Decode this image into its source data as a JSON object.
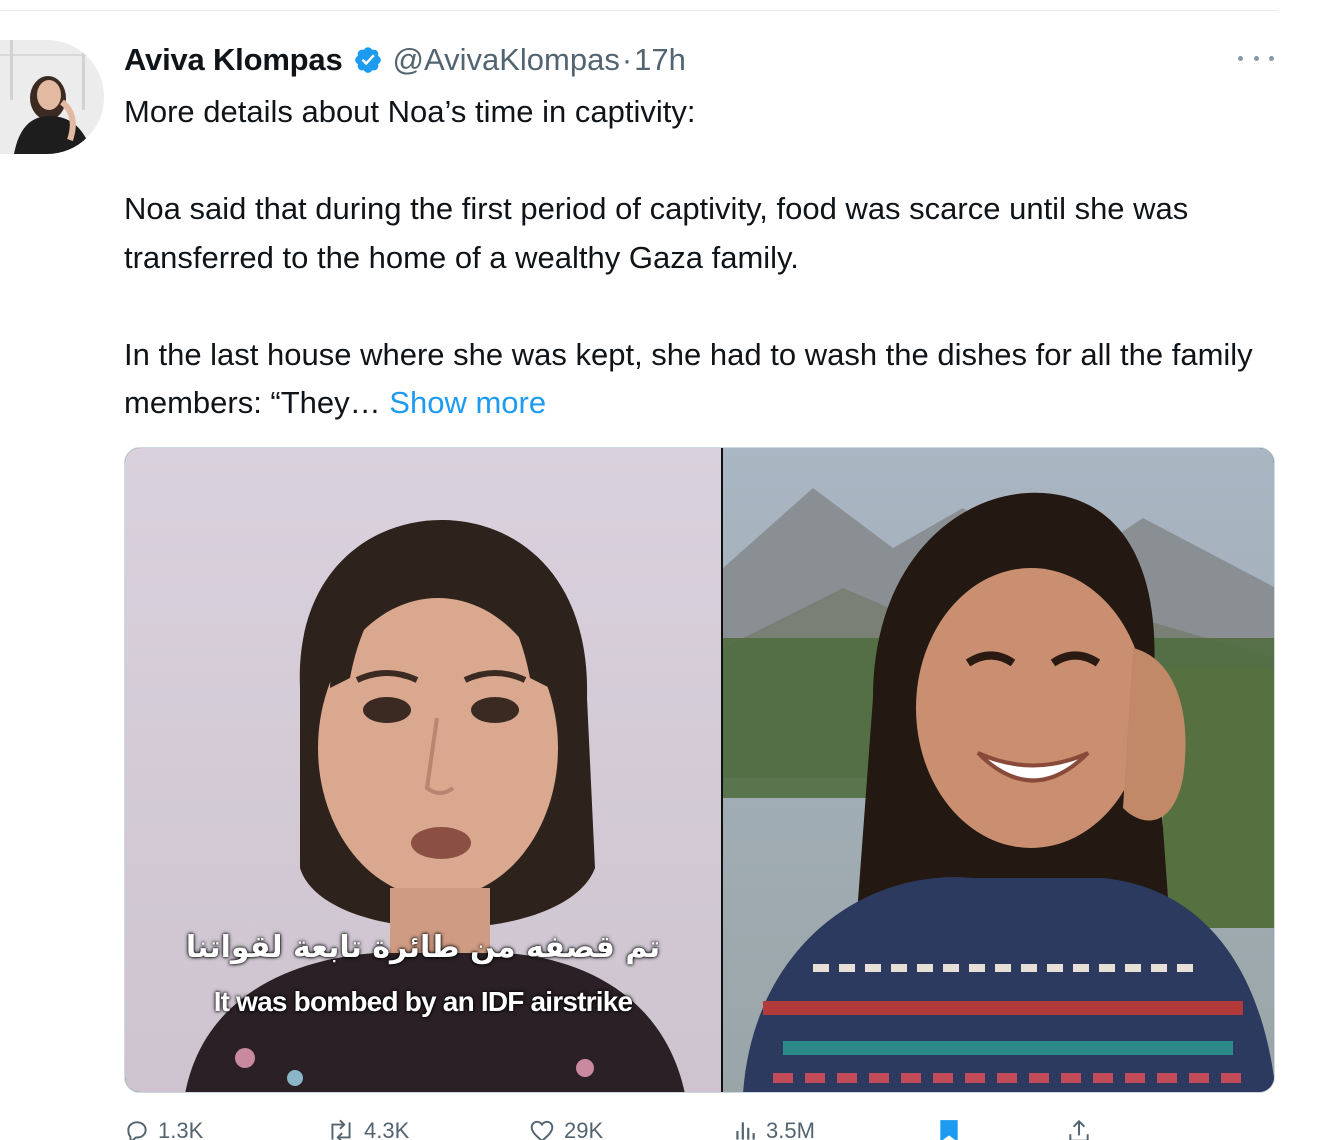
{
  "tweet": {
    "author": {
      "name": "Aviva Klompas",
      "handle": "@AvivaKlompas",
      "verified": true,
      "time": "17h",
      "separator": "·"
    },
    "text_paragraphs": [
      "More details about Noa’s time in captivity:",
      "Noa said that during the first period of captivity, food was scarce until she was transferred to the home of a wealthy Gaza family.",
      "In the last house where she was kept, she had to wash the dishes for all the family members: “They…"
    ],
    "show_more": "Show more",
    "media": {
      "caption_arabic": "تم قصفه من طائرة تابعة لقواتنا",
      "caption_english": "It was bombed by an IDF airstrike"
    },
    "actions": {
      "replies": "1.3K",
      "reposts": "4.3K",
      "likes": "29K",
      "views": "3.5M"
    }
  },
  "colors": {
    "accent": "#1d9bf0",
    "text": "#0f1419",
    "muted": "#536471"
  },
  "icons": {
    "verified": "verified-badge-icon",
    "more": "more-dots-icon",
    "reply": "reply-icon",
    "repost": "repost-icon",
    "like": "heart-icon",
    "views": "views-chart-icon",
    "bookmark": "bookmark-icon",
    "share": "share-icon"
  }
}
